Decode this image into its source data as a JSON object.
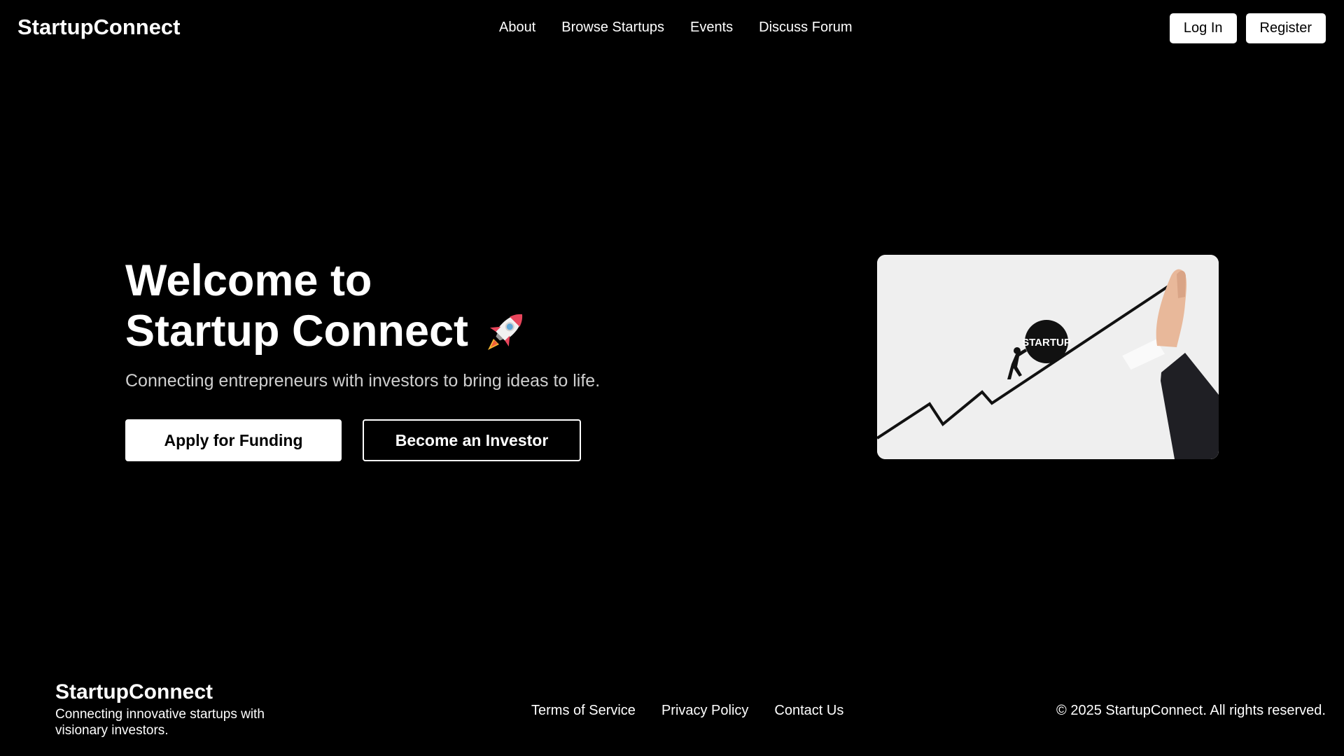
{
  "navbar": {
    "brand": "StartupConnect",
    "links": [
      "About",
      "Browse Startups",
      "Events",
      "Discuss Forum"
    ],
    "login_label": "Log In",
    "register_label": "Register"
  },
  "hero": {
    "title_line1": "Welcome to",
    "title_line2": "Startup Connect",
    "subtitle": "Connecting entrepreneurs with investors to bring ideas to life.",
    "primary_button": "Apply for Funding",
    "secondary_button": "Become an Investor",
    "icon": "rocket-icon",
    "image": {
      "ball_text": "STARTUP"
    }
  },
  "footer": {
    "brand": "StartupConnect",
    "tagline": "Connecting innovative startups with visionary investors.",
    "links": [
      "Terms of Service",
      "Privacy Policy",
      "Contact Us"
    ],
    "copyright": "© 2025 StartupConnect. All rights reserved."
  },
  "colors": {
    "background": "#000000",
    "text": "#ffffff",
    "subtitle": "#cfcfcf",
    "image_bg": "#efefef"
  }
}
